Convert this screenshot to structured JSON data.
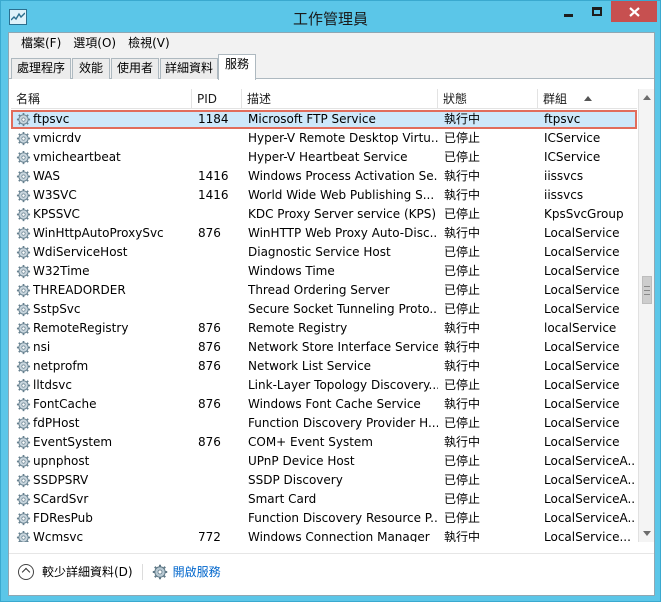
{
  "window": {
    "title": "工作管理員"
  },
  "menu": [
    "檔案(F)",
    "選項(O)",
    "檢視(V)"
  ],
  "tabs": [
    "處理程序",
    "效能",
    "使用者",
    "詳細資料",
    "服務"
  ],
  "active_tab": "服務",
  "columns": {
    "name": "名稱",
    "pid": "PID",
    "desc": "描述",
    "status": "狀態",
    "group": "群組"
  },
  "services": [
    {
      "name": "ftpsvc",
      "pid": "1184",
      "desc": "Microsoft FTP Service",
      "status": "執行中",
      "group": "ftpsvc",
      "selected": true
    },
    {
      "name": "vmicrdv",
      "pid": "",
      "desc": "Hyper-V Remote Desktop Virtu...",
      "status": "已停止",
      "group": "ICService"
    },
    {
      "name": "vmicheartbeat",
      "pid": "",
      "desc": "Hyper-V Heartbeat Service",
      "status": "已停止",
      "group": "ICService"
    },
    {
      "name": "WAS",
      "pid": "1416",
      "desc": "Windows Process Activation Se...",
      "status": "執行中",
      "group": "iissvcs"
    },
    {
      "name": "W3SVC",
      "pid": "1416",
      "desc": "World Wide Web Publishing S...",
      "status": "執行中",
      "group": "iissvcs"
    },
    {
      "name": "KPSSVC",
      "pid": "",
      "desc": "KDC Proxy Server service (KPS)",
      "status": "已停止",
      "group": "KpsSvcGroup"
    },
    {
      "name": "WinHttpAutoProxySvc",
      "pid": "876",
      "desc": "WinHTTP Web Proxy Auto-Disc...",
      "status": "執行中",
      "group": "LocalService"
    },
    {
      "name": "WdiServiceHost",
      "pid": "",
      "desc": "Diagnostic Service Host",
      "status": "已停止",
      "group": "LocalService"
    },
    {
      "name": "W32Time",
      "pid": "",
      "desc": "Windows Time",
      "status": "已停止",
      "group": "LocalService"
    },
    {
      "name": "THREADORDER",
      "pid": "",
      "desc": "Thread Ordering Server",
      "status": "已停止",
      "group": "LocalService"
    },
    {
      "name": "SstpSvc",
      "pid": "",
      "desc": "Secure Socket Tunneling Proto...",
      "status": "已停止",
      "group": "LocalService"
    },
    {
      "name": "RemoteRegistry",
      "pid": "876",
      "desc": "Remote Registry",
      "status": "執行中",
      "group": "localService"
    },
    {
      "name": "nsi",
      "pid": "876",
      "desc": "Network Store Interface Service",
      "status": "執行中",
      "group": "LocalService"
    },
    {
      "name": "netprofm",
      "pid": "876",
      "desc": "Network List Service",
      "status": "執行中",
      "group": "LocalService"
    },
    {
      "name": "lltdsvc",
      "pid": "",
      "desc": "Link-Layer Topology Discovery...",
      "status": "已停止",
      "group": "LocalService"
    },
    {
      "name": "FontCache",
      "pid": "876",
      "desc": "Windows Font Cache Service",
      "status": "執行中",
      "group": "LocalService"
    },
    {
      "name": "fdPHost",
      "pid": "",
      "desc": "Function Discovery Provider H...",
      "status": "已停止",
      "group": "LocalService"
    },
    {
      "name": "EventSystem",
      "pid": "876",
      "desc": "COM+ Event System",
      "status": "執行中",
      "group": "LocalService"
    },
    {
      "name": "upnphost",
      "pid": "",
      "desc": "UPnP Device Host",
      "status": "已停止",
      "group": "LocalServiceA..."
    },
    {
      "name": "SSDPSRV",
      "pid": "",
      "desc": "SSDP Discovery",
      "status": "已停止",
      "group": "LocalServiceA..."
    },
    {
      "name": "SCardSvr",
      "pid": "",
      "desc": "Smart Card",
      "status": "已停止",
      "group": "LocalServiceA..."
    },
    {
      "name": "FDResPub",
      "pid": "",
      "desc": "Function Discovery Resource P...",
      "status": "已停止",
      "group": "LocalServiceA..."
    },
    {
      "name": "Wcmsvc",
      "pid": "772",
      "desc": "Windows Connection Manager",
      "status": "執行中",
      "group": "LocalService..."
    }
  ],
  "footer": {
    "fewer_details": "較少詳細資料(D)",
    "open_services": "開啟服務"
  },
  "colors": {
    "titlebar": "#5bc6e8",
    "close": "#c75050",
    "selection": "#cde8fa",
    "highlight_box": "#e16d5c",
    "link": "#0066cc"
  },
  "icons": {
    "service": "gear-icon"
  }
}
